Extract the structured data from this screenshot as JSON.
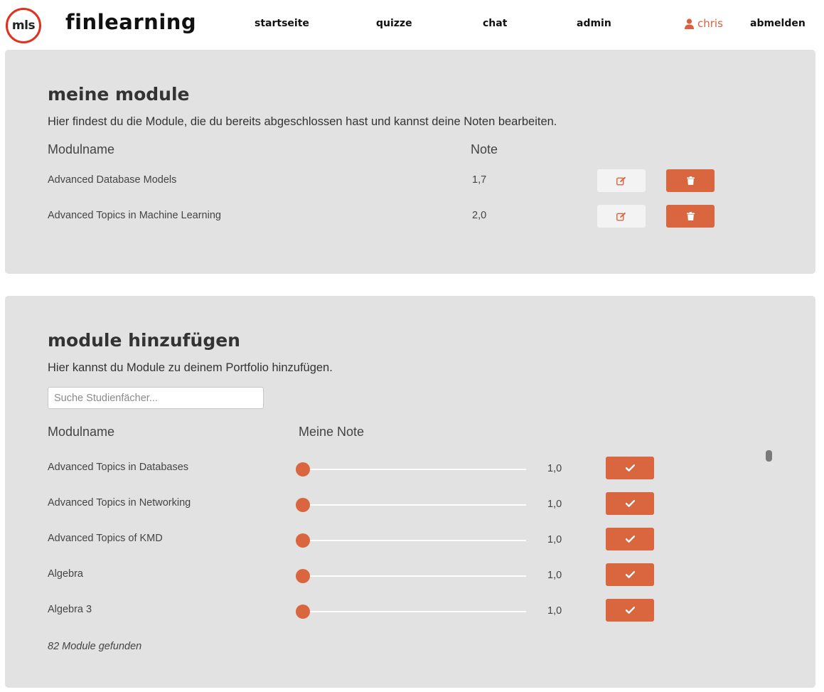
{
  "header": {
    "logo_text": "mls",
    "brand": "finlearning",
    "nav": {
      "startseite": "startseite",
      "quizze": "quizze",
      "chat": "chat",
      "admin": "admin",
      "user": "chris",
      "logout": "abmelden"
    },
    "accent_color": "#d9663f",
    "logo_ring_color": "#e0301e"
  },
  "my_modules": {
    "title": "meine module",
    "description": "Hier findest du die Module, die du bereits abgeschlossen hast und kannst deine Noten bearbeiten.",
    "col_name": "Modulname",
    "col_grade": "Note",
    "rows": [
      {
        "name": "Advanced Database Models",
        "grade": "1,7"
      },
      {
        "name": "Advanced Topics in Machine Learning",
        "grade": "2,0"
      }
    ],
    "icons": {
      "edit": "edit-icon",
      "delete": "trash-icon"
    }
  },
  "add_modules": {
    "title": "module hinzufügen",
    "description": "Hier kannst du Module zu deinem Portfolio hinzufügen.",
    "search_placeholder": "Suche Studienfächer...",
    "col_name": "Modulname",
    "col_grade": "Meine Note",
    "rows": [
      {
        "name": "Advanced Topics in Databases",
        "grade": "1,0",
        "slider_fraction": 0
      },
      {
        "name": "Advanced Topics in Networking",
        "grade": "1,0",
        "slider_fraction": 0
      },
      {
        "name": "Advanced Topics of KMD",
        "grade": "1,0",
        "slider_fraction": 0
      },
      {
        "name": "Algebra",
        "grade": "1,0",
        "slider_fraction": 0
      },
      {
        "name": "Algebra 3",
        "grade": "1,0",
        "slider_fraction": 0
      }
    ],
    "found_text": "82 Module gefunden",
    "icons": {
      "confirm": "check-icon"
    }
  }
}
